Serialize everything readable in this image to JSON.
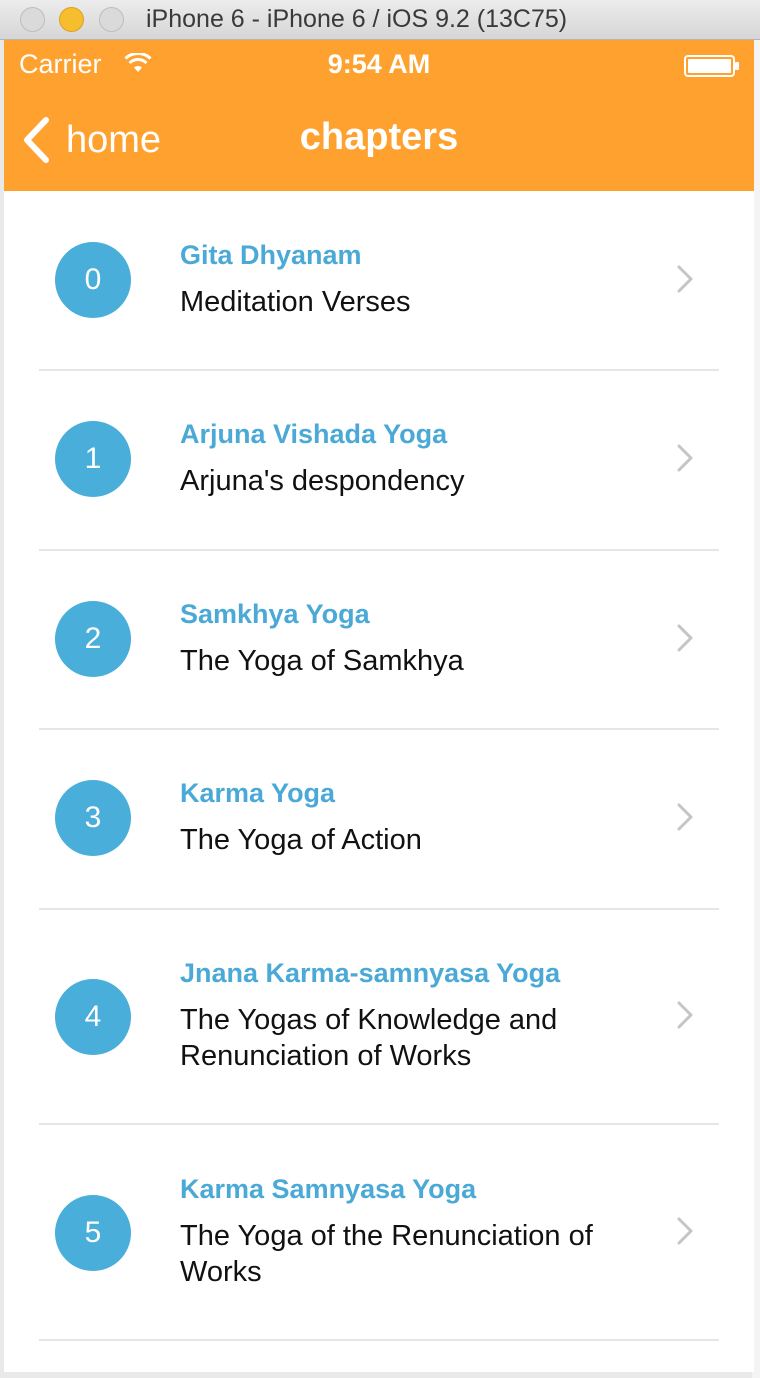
{
  "window": {
    "title": "iPhone 6 - iPhone 6 / iOS 9.2 (13C75)"
  },
  "status_bar": {
    "carrier": "Carrier",
    "time": "9:54 AM"
  },
  "nav_bar": {
    "back_label": "home",
    "title": "chapters",
    "color": "#ffa12f"
  },
  "colors": {
    "accent": "#4aaedb",
    "title_text": "#4aa9d6"
  },
  "chapters": [
    {
      "number": "0",
      "title": "Gita Dhyanam",
      "subtitle": "Meditation Verses"
    },
    {
      "number": "1",
      "title": "Arjuna Vishada Yoga",
      "subtitle": "Arjuna's despondency"
    },
    {
      "number": "2",
      "title": "Samkhya Yoga",
      "subtitle": "The Yoga of Samkhya"
    },
    {
      "number": "3",
      "title": "Karma Yoga",
      "subtitle": "The Yoga of Action"
    },
    {
      "number": "4",
      "title": "Jnana Karma-samnyasa Yoga",
      "subtitle": "The Yogas of Knowledge and Renunciation of Works"
    },
    {
      "number": "5",
      "title": "Karma Samnyasa Yoga",
      "subtitle": "The Yoga of the Renunciation of Works"
    }
  ]
}
